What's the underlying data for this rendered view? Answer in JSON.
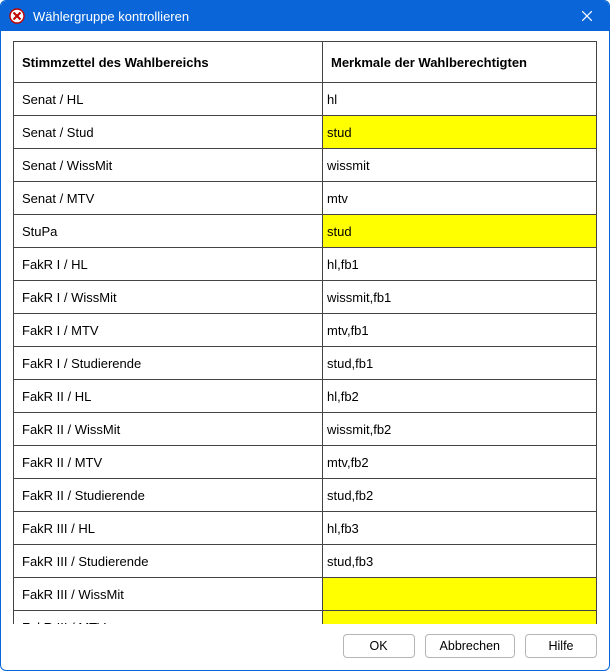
{
  "window": {
    "title": "Wählergruppe kontrollieren"
  },
  "table": {
    "headers": {
      "col1": "Stimmzettel des Wahlbereichs",
      "col2": "Merkmale der Wahlberechtigten"
    },
    "rows": [
      {
        "stimmzettel": "Senat / HL",
        "merkmale": "hl",
        "highlight": false
      },
      {
        "stimmzettel": "Senat / Stud",
        "merkmale": "stud",
        "highlight": true
      },
      {
        "stimmzettel": "Senat / WissMit",
        "merkmale": "wissmit",
        "highlight": false
      },
      {
        "stimmzettel": "Senat / MTV",
        "merkmale": "mtv",
        "highlight": false
      },
      {
        "stimmzettel": "StuPa",
        "merkmale": "stud",
        "highlight": true
      },
      {
        "stimmzettel": "FakR I / HL",
        "merkmale": "hl,fb1",
        "highlight": false
      },
      {
        "stimmzettel": "FakR I / WissMit",
        "merkmale": "wissmit,fb1",
        "highlight": false
      },
      {
        "stimmzettel": "FakR I / MTV",
        "merkmale": "mtv,fb1",
        "highlight": false
      },
      {
        "stimmzettel": "FakR I / Studierende",
        "merkmale": "stud,fb1",
        "highlight": false
      },
      {
        "stimmzettel": "FakR II / HL",
        "merkmale": "hl,fb2",
        "highlight": false
      },
      {
        "stimmzettel": "FakR II / WissMit",
        "merkmale": "wissmit,fb2",
        "highlight": false
      },
      {
        "stimmzettel": "FakR II / MTV",
        "merkmale": "mtv,fb2",
        "highlight": false
      },
      {
        "stimmzettel": "FakR II / Studierende",
        "merkmale": "stud,fb2",
        "highlight": false
      },
      {
        "stimmzettel": "FakR III / HL",
        "merkmale": "hl,fb3",
        "highlight": false
      },
      {
        "stimmzettel": "FakR III / Studierende",
        "merkmale": "stud,fb3",
        "highlight": false
      },
      {
        "stimmzettel": "FakR III / WissMit",
        "merkmale": "",
        "highlight": true
      },
      {
        "stimmzettel": "FakR III / MTV",
        "merkmale": "",
        "highlight": true
      }
    ]
  },
  "buttons": {
    "ok": "OK",
    "cancel": "Abbrechen",
    "help": "Hilfe"
  },
  "colors": {
    "accent": "#0a66d8",
    "highlight": "#ffff00"
  }
}
